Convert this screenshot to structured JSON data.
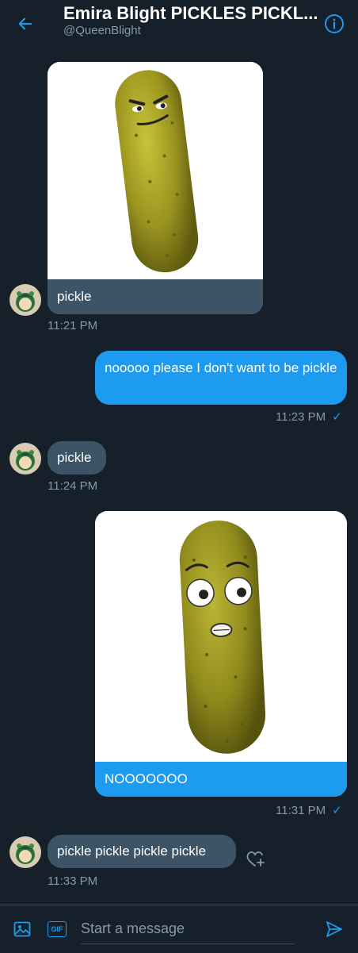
{
  "header": {
    "title": "Emira Blight PICKLES PICKL...",
    "handle": "@QueenBlight",
    "back_icon": "arrow-left-icon",
    "info_icon": "info-icon"
  },
  "messages": [
    {
      "type": "media-received",
      "caption": "pickle",
      "time": "11:21 PM"
    },
    {
      "type": "sent",
      "text": "nooooo please I don't want to be pickle",
      "time": "11:23 PM",
      "status": "✓"
    },
    {
      "type": "received",
      "text": "pickle",
      "time": "11:24 PM"
    },
    {
      "type": "media-sent",
      "caption": "NOOOOOOO",
      "time": "11:31 PM",
      "status": "✓"
    },
    {
      "type": "received",
      "text": "pickle pickle pickle pickle",
      "time": "11:33 PM"
    }
  ],
  "composer": {
    "placeholder": "Start a message",
    "image_icon": "image-icon",
    "gif_label": "GIF",
    "send_icon": "send-icon"
  },
  "colors": {
    "background": "#15202b",
    "accent": "#1d9bf0",
    "received_bubble": "#3d5466",
    "secondary_text": "#8899a6"
  }
}
